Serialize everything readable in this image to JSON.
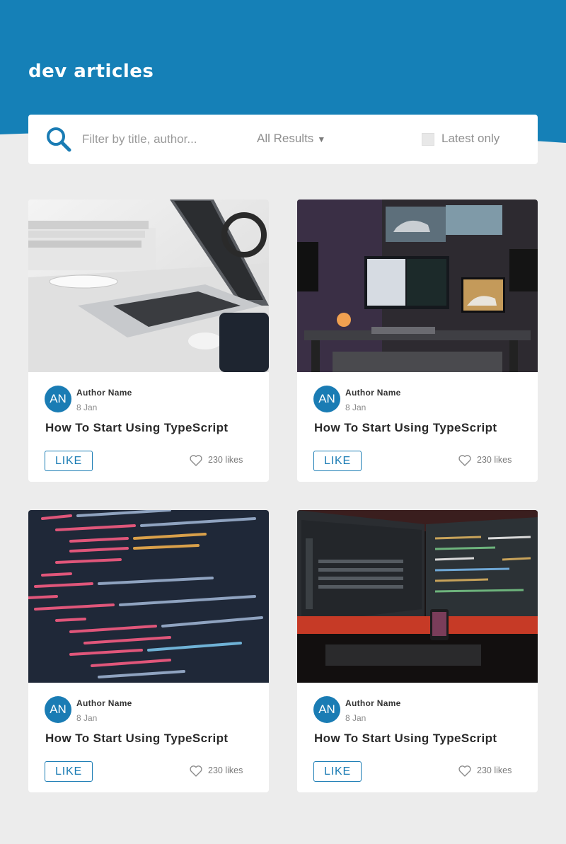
{
  "header": {
    "brand": "dev articles"
  },
  "colors": {
    "accent": "#1a7cb4",
    "background": "#ececec",
    "card": "#ffffff"
  },
  "search": {
    "placeholder": "Filter by title, author...",
    "value": "",
    "icon": "search-icon",
    "filter_label": "All Results",
    "filter_caret": "▼",
    "latest_label": "Latest only",
    "latest_checked": false
  },
  "articles": [
    {
      "image": "laptop-desk-photo",
      "avatar": "AN",
      "author": "Author Name",
      "date": "8 Jan",
      "title": "How To Start Using TypeScript",
      "like_label": "LIKE",
      "likes": "230 likes"
    },
    {
      "image": "desk-setup-photo",
      "avatar": "AN",
      "author": "Author Name",
      "date": "8 Jan",
      "title": "How To Start Using TypeScript",
      "like_label": "LIKE",
      "likes": "230 likes"
    },
    {
      "image": "code-screen-photo",
      "avatar": "AN",
      "author": "Author Name",
      "date": "8 Jan",
      "title": "How To Start Using TypeScript",
      "like_label": "LIKE",
      "likes": "230 likes"
    },
    {
      "image": "monitors-red-light-photo",
      "avatar": "AN",
      "author": "Author Name",
      "date": "8 Jan",
      "title": "How To Start Using TypeScript",
      "like_label": "LIKE",
      "likes": "230 likes"
    }
  ]
}
